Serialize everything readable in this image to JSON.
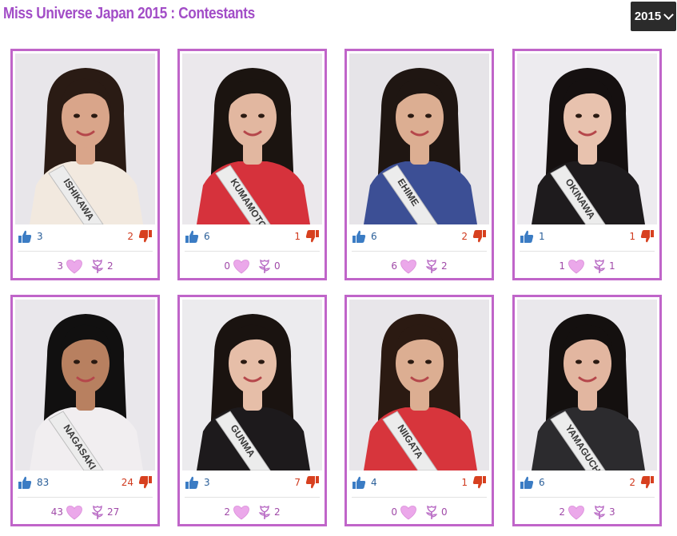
{
  "page": {
    "title": "Miss Universe Japan 2015 : Contestants"
  },
  "year_select": {
    "value": "2015"
  },
  "contestants": [
    {
      "sash": "ISHIKAWA",
      "likes": "3",
      "dislikes": "2",
      "hearts": "3",
      "flowers": "2",
      "bg": "#e8e6ea",
      "dress": "#f2e9df",
      "hair": "#2a1b14",
      "skin": "#d9a58a"
    },
    {
      "sash": "KUMAMOTO",
      "likes": "6",
      "dislikes": "1",
      "hearts": "0",
      "flowers": "0",
      "bg": "#ebe8ec",
      "dress": "#d6323c",
      "hair": "#1b1410",
      "skin": "#e2b7a0"
    },
    {
      "sash": "EHIME",
      "likes": "6",
      "dislikes": "2",
      "hearts": "6",
      "flowers": "2",
      "bg": "#e6e4e8",
      "dress": "#3c4f95",
      "hair": "#1f1612",
      "skin": "#dcae92"
    },
    {
      "sash": "OKINAWA",
      "likes": "1",
      "dislikes": "1",
      "hearts": "1",
      "flowers": "1",
      "bg": "#edebef",
      "dress": "#1e1b1d",
      "hair": "#151010",
      "skin": "#e8c2ae"
    },
    {
      "sash": "NAGASAKI",
      "likes": "83",
      "dislikes": "24",
      "hearts": "43",
      "flowers": "27",
      "bg": "#e9e7eb",
      "dress": "#f1eef0",
      "hair": "#111010",
      "skin": "#b88060"
    },
    {
      "sash": "GUNMA",
      "likes": "3",
      "dislikes": "7",
      "hearts": "2",
      "flowers": "2",
      "bg": "#ecebee",
      "dress": "#1d1a1c",
      "hair": "#1a1310",
      "skin": "#e6bea8"
    },
    {
      "sash": "NIIGATA",
      "likes": "4",
      "dislikes": "1",
      "hearts": "0",
      "flowers": "0",
      "bg": "#e8e6ea",
      "dress": "#d7353c",
      "hair": "#2b1a12",
      "skin": "#dcae92"
    },
    {
      "sash": "YAMAGUCHI",
      "likes": "6",
      "dislikes": "2",
      "hearts": "2",
      "flowers": "3",
      "bg": "#eae8ec",
      "dress": "#2c2b2e",
      "hair": "#14100f",
      "skin": "#e2b6a0"
    }
  ],
  "icons": {
    "like": "thumbs-up-icon",
    "dislike": "thumbs-down-icon",
    "heart": "heart-icon",
    "flower": "flower-icon"
  },
  "colors": {
    "accent": "#c065c9",
    "title": "#a24dc7",
    "like": "#2a5f99",
    "dislike": "#d03a1e",
    "heart": "#e8a4e6"
  }
}
